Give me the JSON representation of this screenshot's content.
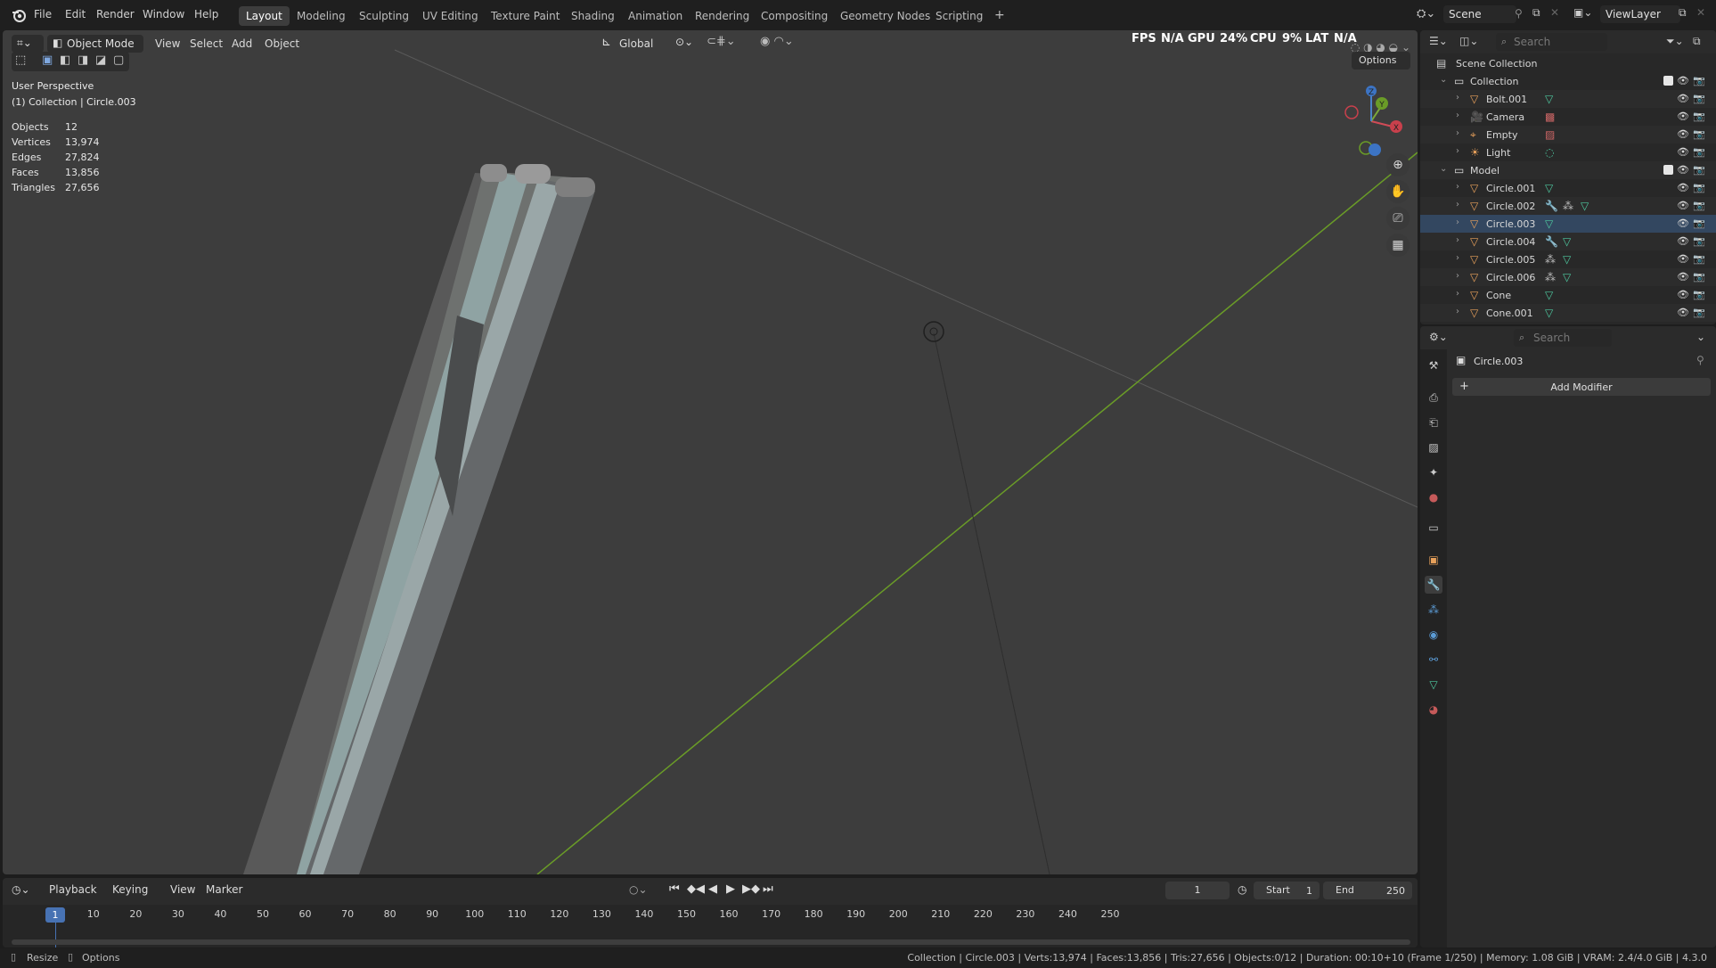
{
  "topbar": {
    "menus": [
      "File",
      "Edit",
      "Render",
      "Window",
      "Help"
    ],
    "workspaces": [
      "Layout",
      "Modeling",
      "Sculpting",
      "UV Editing",
      "Texture Paint",
      "Shading",
      "Animation",
      "Rendering",
      "Compositing",
      "Geometry Nodes",
      "Scripting"
    ],
    "active_workspace": "Layout",
    "add_tab": "+",
    "scene": "Scene",
    "view_layer": "ViewLayer",
    "perf": {
      "fps_label": "FPS",
      "fps": "N/A",
      "gpu_label": "GPU",
      "gpu": "24%",
      "cpu_label": "CPU",
      "cpu": "9%",
      "lat_label": "LAT",
      "lat": "N/A"
    }
  },
  "viewport": {
    "mode": "Object Mode",
    "menus": [
      "View",
      "Select",
      "Add",
      "Object"
    ],
    "orientation": "Global",
    "options": "Options",
    "view_name": "User Perspective",
    "collection_info": "(1) Collection | Circle.003",
    "stats": [
      {
        "label": "Objects",
        "value": "12"
      },
      {
        "label": "Vertices",
        "value": "13,974"
      },
      {
        "label": "Edges",
        "value": "27,824"
      },
      {
        "label": "Faces",
        "value": "13,856"
      },
      {
        "label": "Triangles",
        "value": "27,656"
      }
    ],
    "gizmo": {
      "x": "X",
      "y": "Y",
      "z": "Z"
    }
  },
  "outliner": {
    "search_placeholder": "Search",
    "scene_collection": "Scene Collection",
    "rows": [
      {
        "label": "Collection",
        "indent": 1,
        "type": "collection",
        "arrow": "v"
      },
      {
        "label": "Bolt.001",
        "indent": 2,
        "type": "mesh",
        "arrow": ">"
      },
      {
        "label": "Camera",
        "indent": 2,
        "type": "camera",
        "arrow": ">"
      },
      {
        "label": "Empty",
        "indent": 2,
        "type": "empty",
        "arrow": ">"
      },
      {
        "label": "Light",
        "indent": 2,
        "type": "light",
        "arrow": ">"
      },
      {
        "label": "Model",
        "indent": 1,
        "type": "collection",
        "arrow": "v"
      },
      {
        "label": "Circle.001",
        "indent": 2,
        "type": "mesh",
        "arrow": ">"
      },
      {
        "label": "Circle.002",
        "indent": 2,
        "type": "mesh",
        "arrow": ">"
      },
      {
        "label": "Circle.003",
        "indent": 2,
        "type": "mesh",
        "arrow": ">",
        "selected": true
      },
      {
        "label": "Circle.004",
        "indent": 2,
        "type": "mesh",
        "arrow": ">"
      },
      {
        "label": "Circle.005",
        "indent": 2,
        "type": "mesh",
        "arrow": ">"
      },
      {
        "label": "Circle.006",
        "indent": 2,
        "type": "mesh",
        "arrow": ">"
      },
      {
        "label": "Cone",
        "indent": 2,
        "type": "mesh",
        "arrow": ">"
      },
      {
        "label": "Cone.001",
        "indent": 2,
        "type": "mesh",
        "arrow": ">"
      }
    ]
  },
  "properties": {
    "search_placeholder": "Search",
    "object_name": "Circle.003",
    "add_modifier": "Add Modifier"
  },
  "timeline": {
    "menus": [
      "Playback",
      "Keying",
      "View",
      "Marker"
    ],
    "current_frame": "1",
    "start_label": "Start",
    "start": "1",
    "end_label": "End",
    "end": "250",
    "ticks": [
      "1",
      "10",
      "20",
      "30",
      "40",
      "50",
      "60",
      "70",
      "80",
      "90",
      "100",
      "110",
      "120",
      "130",
      "140",
      "150",
      "160",
      "170",
      "180",
      "190",
      "200",
      "210",
      "220",
      "230",
      "240",
      "250"
    ]
  },
  "statusbar": {
    "left_1": "Resize",
    "left_2": "Options",
    "right": "Collection | Circle.003 | Verts:13,974 | Faces:13,856 | Tris:27,656 | Objects:0/12 | Duration: 00:10+10 (Frame 1/250) | Memory: 1.08 GiB | VRAM: 2.4/4.0 GiB | 4.3.0"
  },
  "colors": {
    "accent": "#4772b3",
    "mesh_icon": "#e8a15b",
    "data_icon": "#4ec9a0",
    "grid_y_axis": "#6a9c27",
    "viewport_bg": "#3d3d3d"
  }
}
